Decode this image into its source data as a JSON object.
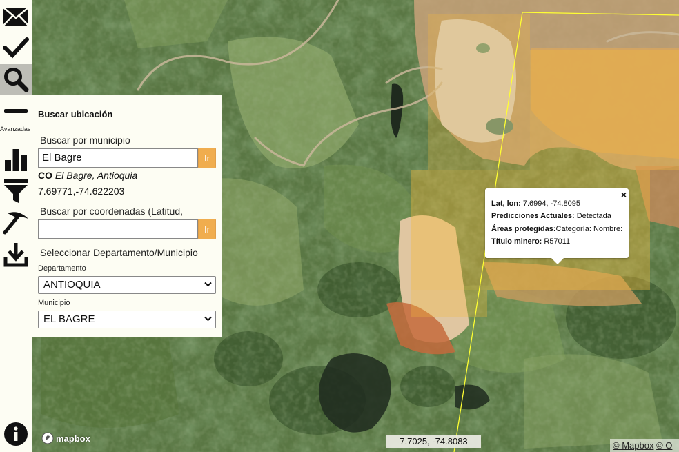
{
  "toolbar": {
    "items": [
      {
        "name": "mail-icon"
      },
      {
        "name": "check-icon"
      },
      {
        "name": "search-icon",
        "active": true
      },
      {
        "name": "minus-icon"
      },
      {
        "name": "bar-chart-icon"
      },
      {
        "name": "filter-icon"
      },
      {
        "name": "pickaxe-icon"
      },
      {
        "name": "download-icon"
      },
      {
        "name": "info-icon"
      }
    ],
    "advanced_label": "Avanzadas"
  },
  "search_panel": {
    "title": "Buscar ubicación",
    "municipality_label": "Buscar por municipio",
    "municipality_value": "El Bagre",
    "go_label": "Ir",
    "result_country": "CO",
    "result_place": "El Bagre, Antioquia",
    "result_coords": "7.69771,-74.622203",
    "coords_label": "Buscar por coordenadas (Latitud, longitud)",
    "coords_value": "",
    "go_label_2": "Ir",
    "select_label": "Seleccionar Departamento/Municipio",
    "department_label": "Departamento",
    "department_value": "ANTIOQUIA",
    "municipio_label": "Municipio",
    "municipio_value": "EL BAGRE"
  },
  "popup": {
    "latlon_label": "Lat, lon:",
    "latlon_value": "7.6994, -74.8095",
    "pred_label": "Predicciones Actuales:",
    "pred_value": "Detectada",
    "areas_label": "Áreas protegidas:",
    "areas_value": "Categoría: Nombre:",
    "titulo_label": "Título minero:",
    "titulo_value": "R57011",
    "close": "×"
  },
  "map": {
    "cursor_coords": "7.7025, -74.8083",
    "logo_text": "mapbox",
    "attribution_mapbox": "© Mapbox",
    "attribution_osm": "© O"
  },
  "colors": {
    "accent": "#f0ad4e",
    "panel_bg": "#fdfdf3",
    "boundary": "#ffff33",
    "detection_overlay": "#f5b83c"
  }
}
